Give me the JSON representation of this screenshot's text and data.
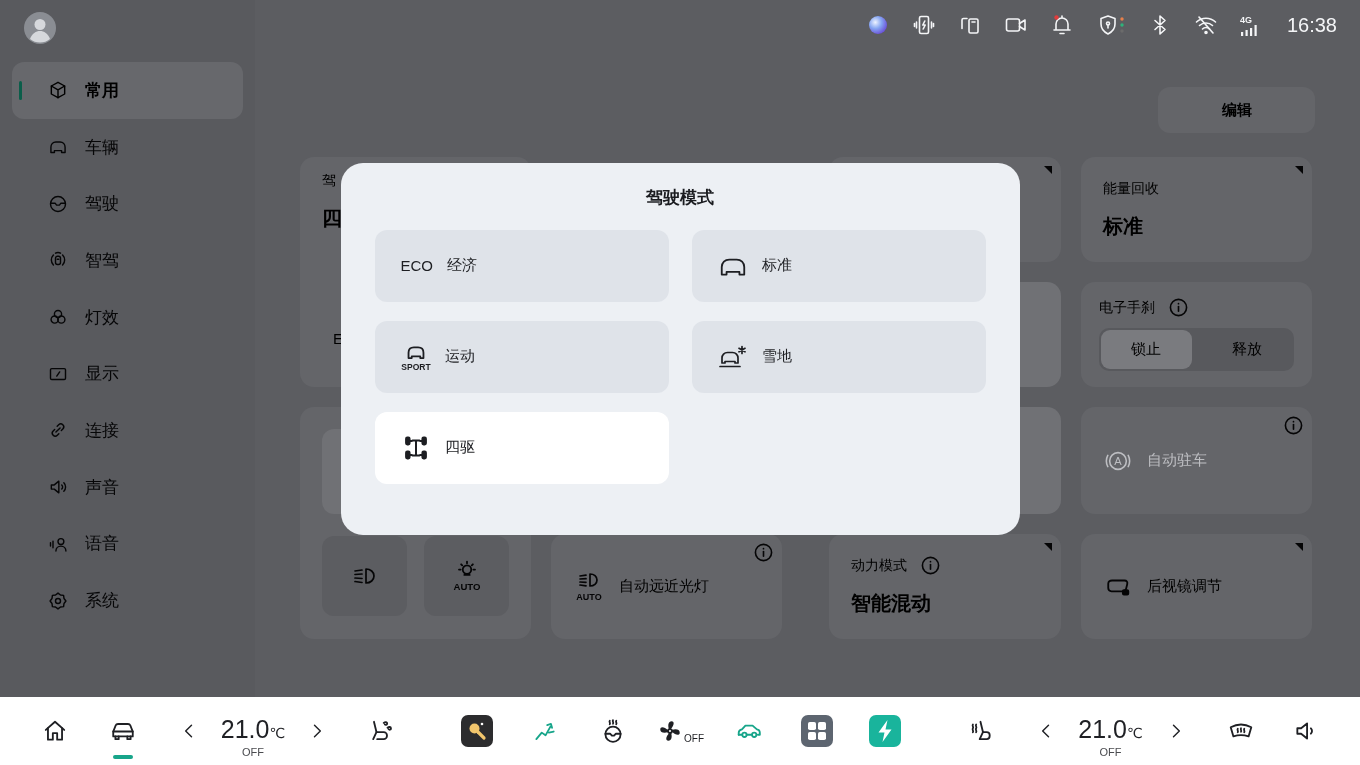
{
  "status_bar": {
    "notification_dot": true,
    "network": "4G",
    "time": "16:38"
  },
  "sidebar": {
    "items": [
      {
        "kind": "cube",
        "label": "常用",
        "selected": true
      },
      {
        "kind": "car",
        "label": "车辆",
        "selected": false
      },
      {
        "kind": "steering",
        "label": "驾驶",
        "selected": false
      },
      {
        "kind": "assist",
        "label": "智驾",
        "selected": false
      },
      {
        "kind": "lights",
        "label": "灯效",
        "selected": false
      },
      {
        "kind": "display",
        "label": "显示",
        "selected": false
      },
      {
        "kind": "link",
        "label": "连接",
        "selected": false
      },
      {
        "kind": "sound",
        "label": "声音",
        "selected": false
      },
      {
        "kind": "voice",
        "label": "语音",
        "selected": false
      },
      {
        "kind": "gear",
        "label": "系统",
        "selected": false
      }
    ]
  },
  "edit_button": "编辑",
  "cards": [
    {
      "kind": "value",
      "label": "驾",
      "value": "四",
      "option": "E"
    },
    {
      "kind": "blank",
      "more": true
    },
    {
      "kind": "value",
      "label": "能量回收",
      "value": "标准",
      "more": true
    },
    {
      "kind": "panel"
    },
    {
      "kind": "segmented",
      "label": "电子手刹",
      "info": true,
      "options": [
        {
          "label": "锁止",
          "selected": true
        },
        {
          "label": "释放",
          "selected": false
        }
      ]
    },
    {
      "kind": "lights",
      "tiles": [
        {
          "kind": "beam"
        },
        {
          "kind": "auto-light",
          "caption": "AUTO"
        }
      ]
    },
    {
      "kind": "panel"
    },
    {
      "kind": "switch",
      "badge": "A",
      "label": "自动驻车",
      "disabled": true,
      "info": true
    },
    {
      "kind": "auto-beam",
      "caption": "AUTO",
      "label": "自动远近光灯",
      "info": true
    },
    {
      "kind": "value",
      "label": "动力模式",
      "value": "智能混动",
      "info": true,
      "more": true
    },
    {
      "kind": "mirror",
      "label": "后视镜调节",
      "more": true
    }
  ],
  "dialog": {
    "title": "驾驶模式",
    "modes": [
      {
        "kind": "text",
        "badge": "ECO",
        "label": "经济",
        "selected": false
      },
      {
        "kind": "car",
        "label": "标准",
        "selected": false
      },
      {
        "kind": "sport",
        "badge": "SPORT",
        "label": "运动",
        "selected": false
      },
      {
        "kind": "snow",
        "label": "雪地",
        "selected": false
      },
      {
        "kind": "awd",
        "label": "四驱",
        "selected": true
      }
    ]
  },
  "dock": {
    "left": [
      {
        "kind": "home",
        "selected": false
      },
      {
        "kind": "car",
        "selected": true
      },
      {
        "kind": "temperature",
        "value": "21.0",
        "unit": "℃",
        "state": "OFF"
      },
      {
        "kind": "seat-vent",
        "on": false
      }
    ],
    "center": [
      {
        "kind": "app-light"
      },
      {
        "kind": "recline",
        "on": true
      },
      {
        "kind": "wheel-heat",
        "on": false
      },
      {
        "kind": "fan",
        "state": "OFF"
      },
      {
        "kind": "car-outline",
        "on": true
      },
      {
        "kind": "app-grid"
      },
      {
        "kind": "app-charge"
      }
    ],
    "right": [
      {
        "kind": "seat-heat",
        "on": false
      },
      {
        "kind": "temperature",
        "value": "21.0",
        "unit": "℃",
        "state": "OFF"
      },
      {
        "kind": "defrost",
        "on": false
      },
      {
        "kind": "volume",
        "on": false
      }
    ]
  }
}
